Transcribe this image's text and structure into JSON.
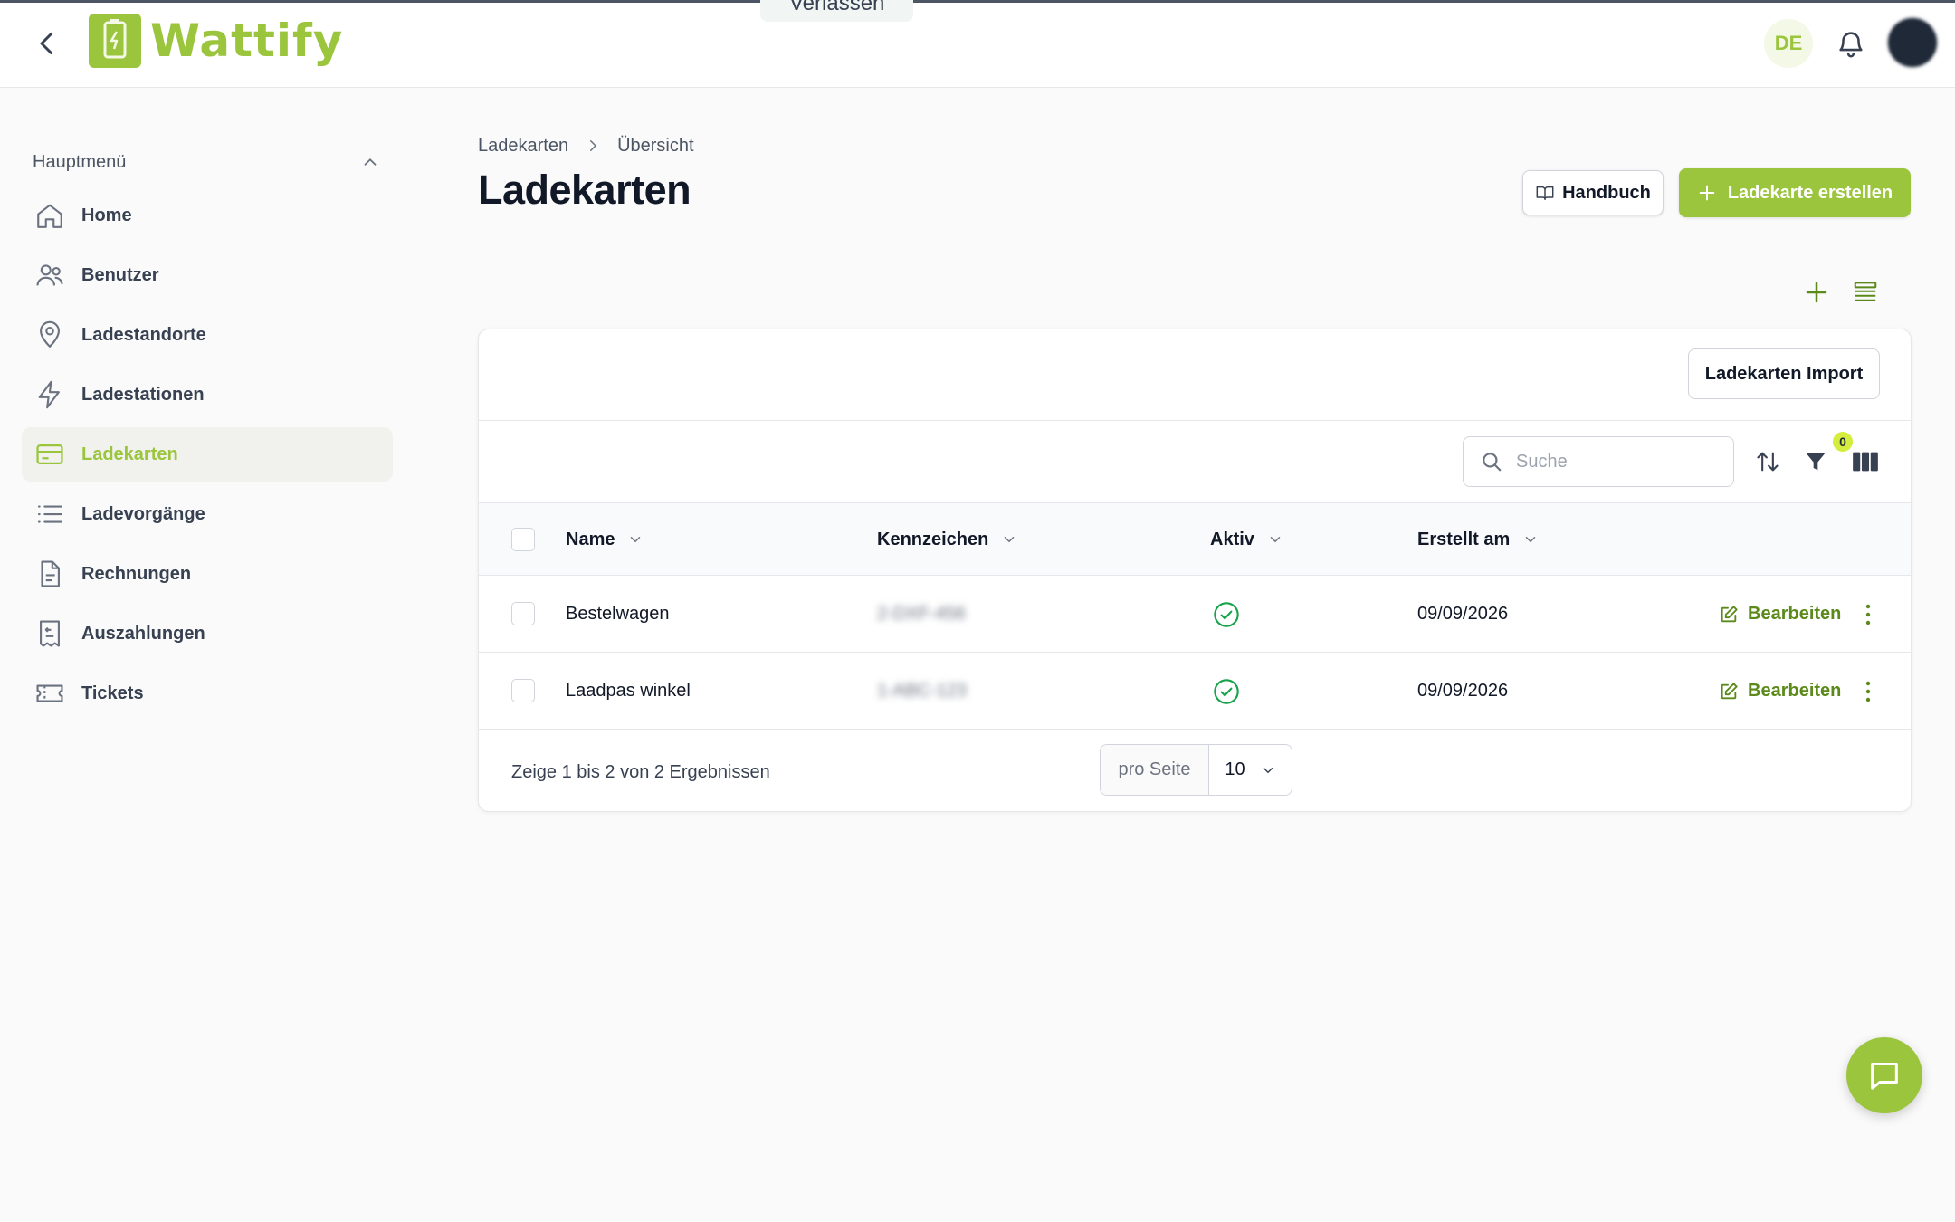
{
  "app": {
    "name": "Wattify",
    "language": "DE",
    "impersonation_leave_label": "Verlassen"
  },
  "colors": {
    "brand": "#9bc53d",
    "edit_link": "#5b8a1a",
    "active_check": "#16a34a"
  },
  "sidebar": {
    "section_title": "Hauptmenü",
    "items": [
      {
        "label": "Home",
        "icon": "home-icon",
        "active": false
      },
      {
        "label": "Benutzer",
        "icon": "users-icon",
        "active": false
      },
      {
        "label": "Ladestandorte",
        "icon": "map-pin-icon",
        "active": false
      },
      {
        "label": "Ladestationen",
        "icon": "lightning-icon",
        "active": false
      },
      {
        "label": "Ladekarten",
        "icon": "credit-card-icon",
        "active": true
      },
      {
        "label": "Ladevorgänge",
        "icon": "list-icon",
        "active": false
      },
      {
        "label": "Rechnungen",
        "icon": "document-icon",
        "active": false
      },
      {
        "label": "Auszahlungen",
        "icon": "receipt-icon",
        "active": false
      },
      {
        "label": "Tickets",
        "icon": "ticket-icon",
        "active": false
      }
    ]
  },
  "breadcrumb": {
    "parent": "Ladekarten",
    "current": "Übersicht"
  },
  "page": {
    "title": "Ladekarten",
    "handbook_label": "Handbuch",
    "create_label": "Ladekarte erstellen"
  },
  "table": {
    "import_label": "Ladekarten Import",
    "search": {
      "placeholder": "Suche",
      "value": ""
    },
    "filter_count": "0",
    "columns": [
      "Name",
      "Kennzeichen",
      "Aktiv",
      "Erstellt am"
    ],
    "rows": [
      {
        "name": "Bestelwagen",
        "plate": "2-DXF-456",
        "active": true,
        "created": "09/09/2026",
        "edit_label": "Bearbeiten"
      },
      {
        "name": "Laadpas winkel",
        "plate": "1-ABC-123",
        "active": true,
        "created": "09/09/2026",
        "edit_label": "Bearbeiten"
      }
    ],
    "results_text": "Zeige 1 bis 2 von 2 Ergebnissen",
    "per_page_label": "pro Seite",
    "per_page_value": "10"
  }
}
